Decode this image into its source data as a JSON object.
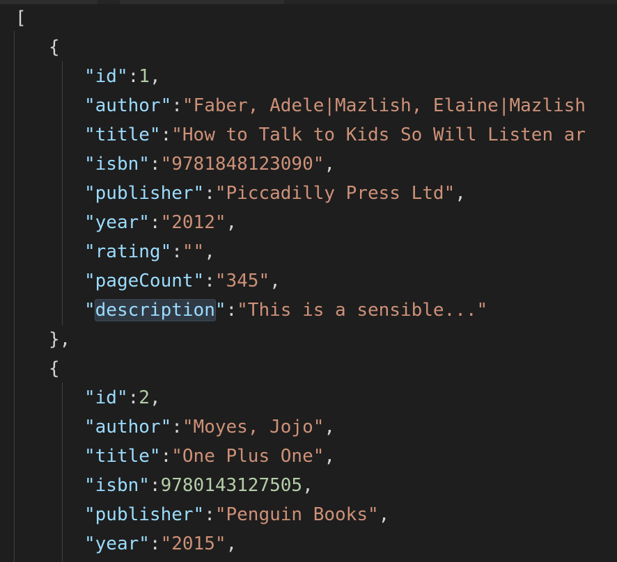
{
  "editor": {
    "open_bracket": "[",
    "objects": [
      {
        "open": "{",
        "close": "},",
        "fields": [
          {
            "key": "\"id\"",
            "sep": ":",
            "value": "1",
            "value_type": "num",
            "tail": ","
          },
          {
            "key": "\"author\"",
            "sep": ":",
            "value": "\"Faber, Adele|Mazlish, Elaine|Mazlish",
            "value_type": "str",
            "tail": ""
          },
          {
            "key": "\"title\"",
            "sep": ":",
            "value": "\"How to Talk to Kids So Will Listen ar",
            "value_type": "str",
            "tail": ""
          },
          {
            "key": "\"isbn\"",
            "sep": ":",
            "value": "\"9781848123090\"",
            "value_type": "str",
            "tail": ","
          },
          {
            "key": "\"publisher\"",
            "sep": ":",
            "value": "\"Piccadilly Press Ltd\"",
            "value_type": "str",
            "tail": ","
          },
          {
            "key": "\"year\"",
            "sep": ":",
            "value": "\"2012\"",
            "value_type": "str",
            "tail": ","
          },
          {
            "key": "\"rating\"",
            "sep": ":",
            "value": "\"\"",
            "value_type": "str",
            "tail": ","
          },
          {
            "key": "\"pageCount\"",
            "sep": ":",
            "value": "\"345\"",
            "value_type": "str",
            "tail": ","
          },
          {
            "key_open_quote": "\"",
            "key_word": "description",
            "key_close_quote": "\"",
            "sep": ":",
            "value": "\"This is a sensible...\"",
            "value_type": "str",
            "tail": ""
          }
        ]
      },
      {
        "open": "{",
        "fields": [
          {
            "key": "\"id\"",
            "sep": ":",
            "value": "2",
            "value_type": "num",
            "tail": ","
          },
          {
            "key": "\"author\"",
            "sep": ":",
            "value": "\"Moyes, Jojo\"",
            "value_type": "str",
            "tail": ","
          },
          {
            "key": "\"title\"",
            "sep": ":",
            "value": "\"One Plus One\"",
            "value_type": "str",
            "tail": ","
          },
          {
            "key": "\"isbn\"",
            "sep": ":",
            "value": "9780143127505",
            "value_type": "num",
            "tail": ","
          },
          {
            "key": "\"publisher\"",
            "sep": ":",
            "value": "\"Penguin Books\"",
            "value_type": "str",
            "tail": ","
          },
          {
            "key": "\"year\"",
            "sep": ":",
            "value": "\"2015\"",
            "value_type": "str",
            "tail": ","
          }
        ]
      }
    ]
  },
  "colors": {
    "background": "#1e1e1e",
    "key": "#9cdcfe",
    "string": "#ce9178",
    "number": "#b5cea8",
    "punctuation": "#d4d4d4",
    "indent_guide": "#404040",
    "word_highlight": "#303a45"
  }
}
